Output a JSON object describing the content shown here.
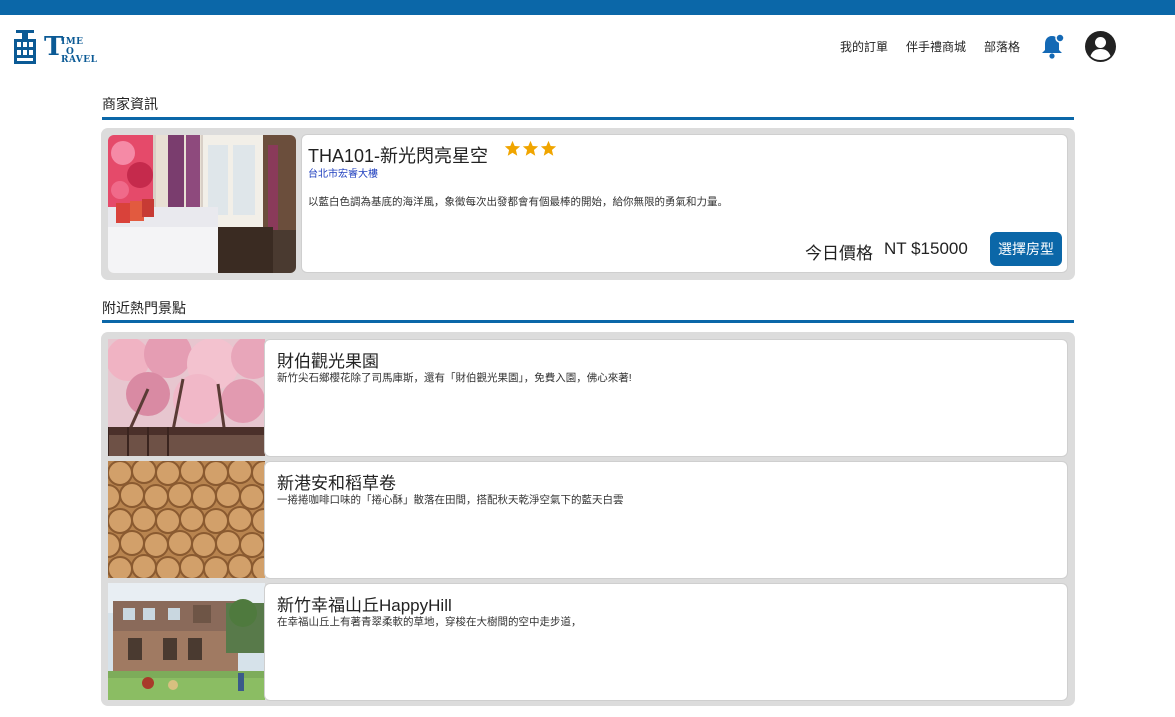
{
  "header": {
    "logo_title": "TIME TO TRAVEL",
    "logo_letters": {
      "big_t1": "T",
      "ime": "IME",
      "o": "O",
      "big_t2": "T",
      "ravel": "RAVEL"
    },
    "nav": [
      {
        "label": "我的訂單"
      },
      {
        "label": "伴手禮商城"
      },
      {
        "label": "部落格"
      }
    ],
    "icons": {
      "bell": "bell-icon",
      "user": "user-account-icon"
    },
    "colors": {
      "brand": "#0b67a8"
    }
  },
  "merchant": {
    "section_title": "商家資訊",
    "name": "THA101-新光閃亮星空",
    "rating": 3,
    "address": "台北市宏睿大樓",
    "description": "以藍白色調為基底的海洋風，象徵每次出發都會有個最棒的開始，給你無限的勇氣和力量。",
    "price_label": "今日價格",
    "price_value": "NT $15000",
    "button_label": "選擇房型"
  },
  "nearby": {
    "section_title": "附近熱門景點",
    "items": [
      {
        "name": "財伯觀光果園",
        "description": "新竹尖石鄉櫻花除了司馬庫斯，還有「財伯觀光果園」，免費入園，佛心來著!",
        "image": "cherry-blossom-photo"
      },
      {
        "name": "新港安和稻草卷",
        "description": "一捲捲咖啡口味的「捲心酥」散落在田間，搭配秋天乾淨空氣下的藍天白雲",
        "image": "hay-bales-photo"
      },
      {
        "name": "新竹幸福山丘HappyHill",
        "description": "在幸福山丘上有著青翠柔軟的草地，穿梭在大樹間的空中走步道，",
        "image": "container-building-photo"
      }
    ]
  }
}
